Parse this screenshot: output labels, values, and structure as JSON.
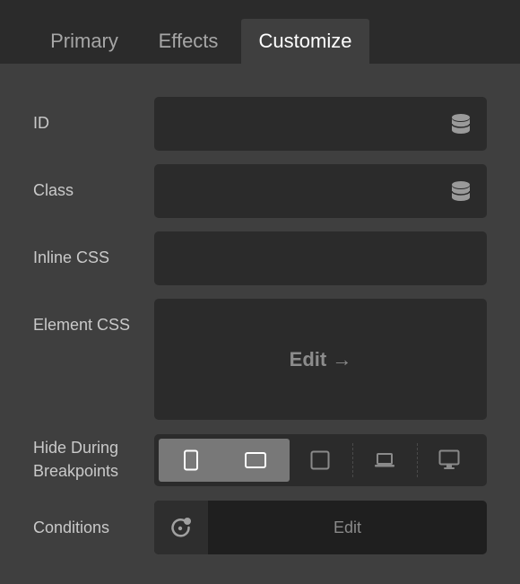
{
  "tabs": [
    {
      "label": "Primary",
      "active": false
    },
    {
      "label": "Effects",
      "active": false
    },
    {
      "label": "Customize",
      "active": true
    }
  ],
  "fields": {
    "id": {
      "label": "ID",
      "value": "",
      "icon": "database-icon"
    },
    "class": {
      "label": "Class",
      "value": "",
      "icon": "database-icon"
    },
    "inline_css": {
      "label": "Inline CSS",
      "value": ""
    }
  },
  "element_css": {
    "label": "Element CSS",
    "edit_label": "Edit →"
  },
  "hide_breakpoints": {
    "label_line1": "Hide During",
    "label_line2": "Breakpoints",
    "options": [
      {
        "icon": "mobile-portrait-icon",
        "selected": true
      },
      {
        "icon": "mobile-landscape-icon",
        "selected": true
      },
      {
        "icon": "tablet-icon",
        "selected": false
      },
      {
        "icon": "laptop-icon",
        "selected": false
      },
      {
        "icon": "desktop-icon",
        "selected": false
      }
    ]
  },
  "conditions": {
    "label": "Conditions",
    "edit_label": "Edit",
    "icon": "conditions-icon"
  },
  "colors": {
    "panel": "#3f3f3f",
    "tabbar": "#2b2b2b",
    "field": "#2b2b2b",
    "selected": "#787878"
  }
}
